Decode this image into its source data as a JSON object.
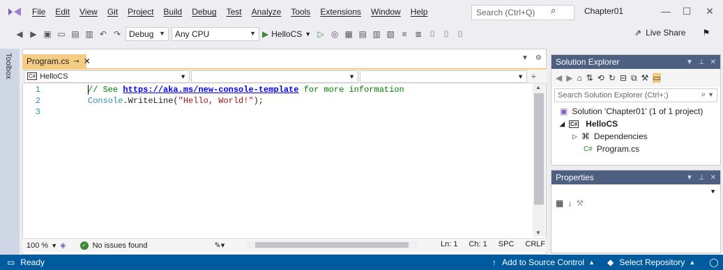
{
  "menubar": {
    "items": [
      "File",
      "Edit",
      "View",
      "Git",
      "Project",
      "Build",
      "Debug",
      "Test",
      "Analyze",
      "Tools",
      "Extensions",
      "Window",
      "Help"
    ],
    "search_placeholder": "Search (Ctrl+Q)",
    "solution_name": "Chapter01"
  },
  "toolbar": {
    "config": "Debug",
    "platform": "Any CPU",
    "run_label": "HelloCS",
    "live_share": "Live Share"
  },
  "toolbox_label": "Toolbox",
  "editor": {
    "tab_title": "Program.cs",
    "nav_project": "HelloCS",
    "line_numbers": [
      "1",
      "2",
      "3"
    ],
    "line1_prefix": "// See ",
    "line1_link": "https://aka.ms/new-console-template",
    "line1_suffix": " for more information",
    "line2_class": "Console",
    "line2_method": ".WriteLine(",
    "line2_string": "\"Hello, World!\"",
    "line2_end": ");",
    "zoom": "100 %",
    "issues": "No issues found",
    "ln": "Ln: 1",
    "ch": "Ch: 1",
    "spc": "SPC",
    "crlf": "CRLF"
  },
  "solution_explorer": {
    "title": "Solution Explorer",
    "search_placeholder": "Search Solution Explorer (Ctrl+;)",
    "solution_label": "Solution 'Chapter01' (1 of 1 project)",
    "project": "HelloCS",
    "dependencies": "Dependencies",
    "file": "Program.cs"
  },
  "properties": {
    "title": "Properties"
  },
  "statusbar": {
    "ready": "Ready",
    "add_source": "Add to Source Control",
    "select_repo": "Select Repository"
  },
  "colors": {
    "accent": "#005a9e",
    "tab_active": "#f5cc84",
    "panel_title": "#4d6082"
  }
}
